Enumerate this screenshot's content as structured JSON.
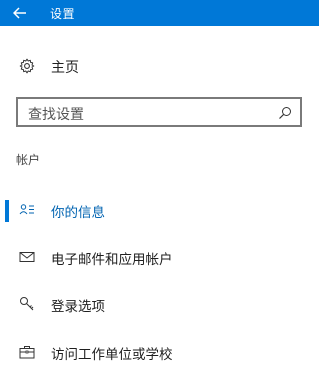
{
  "titlebar": {
    "title": "设置",
    "back_icon": "back-arrow-icon",
    "bg_color": "#0078d7"
  },
  "home": {
    "label": "主页",
    "icon": "gear-icon"
  },
  "search": {
    "placeholder": "查找设置",
    "icon": "search-icon"
  },
  "section": {
    "header": "帐户"
  },
  "nav": {
    "items": [
      {
        "label": "你的信息",
        "icon": "person-info-icon",
        "selected": true
      },
      {
        "label": "电子邮件和应用帐户",
        "icon": "mail-icon",
        "selected": false
      },
      {
        "label": "登录选项",
        "icon": "key-icon",
        "selected": false
      },
      {
        "label": "访问工作单位或学校",
        "icon": "briefcase-icon",
        "selected": false
      }
    ]
  },
  "accent_color": "#0078d7"
}
